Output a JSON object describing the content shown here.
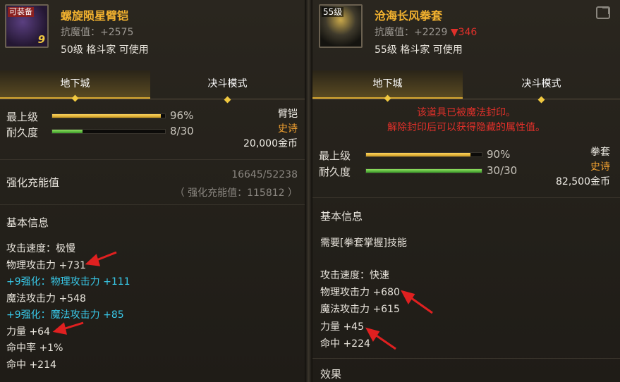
{
  "left": {
    "icon_tag": "可装备",
    "icon_number": "9",
    "icon_name": "gauntlet-icon",
    "name": "螺旋陨星臂铠",
    "resist": "抗魔值：+2575",
    "requirement": "50级 格斗家 可使用",
    "tabs": [
      "地下城",
      "决斗模式"
    ],
    "max_level_label": "最上级",
    "max_level_value": "96%",
    "max_level_fraction": 0.96,
    "durability_label": "耐久度",
    "durability_value": "8/30",
    "durability_fraction": 0.267,
    "type": "臂铠",
    "rarity": "史诗",
    "price": "20,000金币",
    "reinforce_label": "强化充能值",
    "reinforce_value": "16645/52238",
    "reinforce_sub": "（ 强化充能值：115812 ）",
    "basic_info_title": "基本信息",
    "stats": [
      {
        "text": "攻击速度：极慢",
        "color": "white"
      },
      {
        "text": "物理攻击力 +731",
        "color": "white"
      },
      {
        "text": "+9强化：物理攻击力 +111",
        "color": "cyan"
      },
      {
        "text": "魔法攻击力 +548",
        "color": "white"
      },
      {
        "text": "+9强化：魔法攻击力 +85",
        "color": "cyan"
      },
      {
        "text": "力量 +64",
        "color": "white"
      },
      {
        "text": "命中率 +1%",
        "color": "white"
      },
      {
        "text": "命中 +214",
        "color": "white"
      }
    ]
  },
  "right": {
    "icon_level": "55级",
    "icon_name": "fist-icon",
    "name": "沧海长风拳套",
    "resist_prefix": "抗魔值：+2229 ",
    "resist_diff": "▼346",
    "requirement": "55级 格斗家 可使用",
    "tabs": [
      "地下城",
      "决斗模式"
    ],
    "seal_line1": "该道具已被魔法封印。",
    "seal_line2": "解除封印后可以获得隐藏的属性值。",
    "max_level_label": "最上级",
    "max_level_value": "90%",
    "max_level_fraction": 0.9,
    "durability_label": "耐久度",
    "durability_value": "30/30",
    "durability_fraction": 1.0,
    "type": "拳套",
    "rarity": "史诗",
    "price": "82,500金币",
    "basic_info_title": "基本信息",
    "skill_req": "需要[拳套掌握]技能",
    "stats": [
      {
        "text": "攻击速度：快速",
        "color": "white"
      },
      {
        "text": "物理攻击力 +680",
        "color": "white"
      },
      {
        "text": "魔法攻击力 +615",
        "color": "white"
      },
      {
        "text": "力量 +45",
        "color": "white"
      },
      {
        "text": "命中 +224",
        "color": "white"
      }
    ],
    "effect_title": "效果"
  },
  "colors": {
    "name": "#f3b22f",
    "cyan": "#38c8e8",
    "seal_red": "#e0302a",
    "arrow_red": "#e02020",
    "rarity": "#f0a030"
  }
}
